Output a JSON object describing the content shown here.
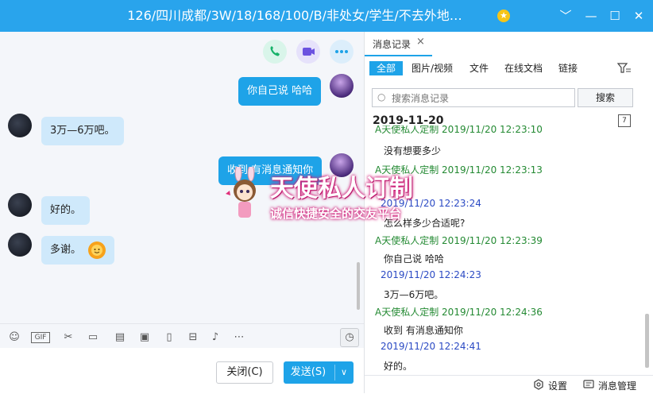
{
  "window": {
    "title": "126/四川成都/3W/18/168/100/B/非处女/学生/不去外地…",
    "controls": [
      "﹀",
      "—",
      "☐",
      "✕"
    ]
  },
  "chat": {
    "messages": [
      {
        "side": "right",
        "text": "你自己说 哈哈"
      },
      {
        "side": "left",
        "text": "3万—6万吧。"
      },
      {
        "side": "right",
        "text": "收到 有消息通知你"
      },
      {
        "side": "left",
        "text": "好的。"
      },
      {
        "side": "left",
        "text": "多谢。"
      }
    ],
    "toolbar_icons": [
      "emoji-icon",
      "gif-icon",
      "scissors-icon",
      "folder-icon",
      "image-collage-icon",
      "image-icon",
      "vibrate-icon",
      "red-packet-icon",
      "music-icon",
      "more-icon",
      "history-clock-icon"
    ],
    "close_label": "关闭(C)",
    "send_label": "发送(S)"
  },
  "history": {
    "tab_label": "消息记录",
    "filters": [
      "全部",
      "图片/视频",
      "文件",
      "在线文档",
      "链接"
    ],
    "search_placeholder": "搜索消息记录",
    "search_button": "搜索",
    "date": "2019-11-20",
    "entries": [
      {
        "sender": "A天使私人定制",
        "time": "2019/11/20 12:23:10",
        "color": "green",
        "text": "没有想要多少"
      },
      {
        "sender": "A天使私人定制",
        "time": "2019/11/20 12:23:13",
        "color": "green",
        "text": ""
      },
      {
        "sender": "",
        "time": "2019/11/20 12:23:24",
        "color": "blue",
        "text": "怎么样多少合适呢?"
      },
      {
        "sender": "A天使私人定制",
        "time": "2019/11/20 12:23:39",
        "color": "green",
        "text": "你自己说 哈哈"
      },
      {
        "sender": "",
        "time": "2019/11/20 12:24:23",
        "color": "blue",
        "text": "3万—6万吧。"
      },
      {
        "sender": "A天使私人定制",
        "time": "2019/11/20 12:24:36",
        "color": "green",
        "text": "收到 有消息通知你"
      },
      {
        "sender": "",
        "time": "2019/11/20 12:24:41",
        "color": "blue",
        "text": "好的。"
      }
    ],
    "settings_label": "设置",
    "manage_label": "消息管理"
  },
  "watermark": {
    "line1": "天使私人订制",
    "line2": "诚信快捷安全的交友平台"
  },
  "colors": {
    "accent": "#1ea3e8",
    "title_bar": "#29a4ec",
    "green_sender": "#248a33",
    "blue_sender": "#2b4ac4"
  }
}
